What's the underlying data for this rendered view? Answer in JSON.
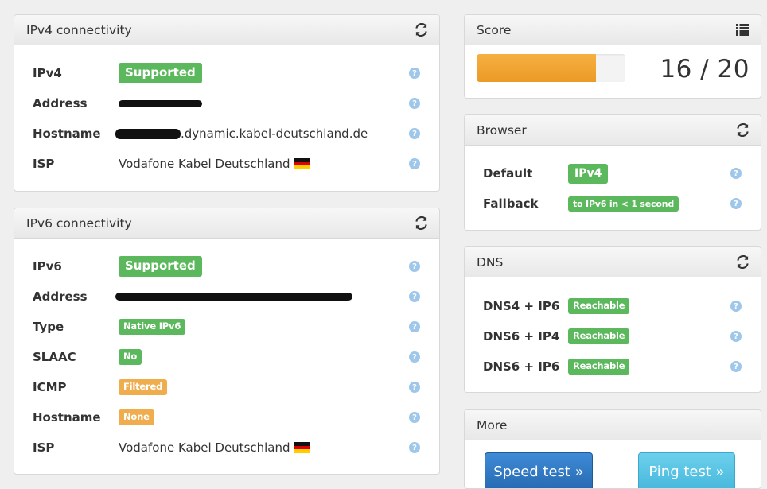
{
  "ipv4": {
    "title": "IPv4 connectivity",
    "rows": [
      {
        "label": "IPv4",
        "badge": "Supported"
      },
      {
        "label": "Address"
      },
      {
        "label": "Hostname",
        "suffix": ".dynamic.kabel-deutschland.de"
      },
      {
        "label": "ISP",
        "value": "Vodafone Kabel Deutschland"
      }
    ]
  },
  "ipv6": {
    "title": "IPv6 connectivity",
    "rows": [
      {
        "label": "IPv6",
        "badge": "Supported"
      },
      {
        "label": "Address"
      },
      {
        "label": "Type",
        "badge": "Native IPv6"
      },
      {
        "label": "SLAAC",
        "badge": "No"
      },
      {
        "label": "ICMP",
        "badge": "Filtered"
      },
      {
        "label": "Hostname",
        "badge": "None"
      },
      {
        "label": "ISP",
        "value": "Vodafone Kabel Deutschland"
      }
    ]
  },
  "score": {
    "title": "Score",
    "text": "16 / 20",
    "fraction": 0.8
  },
  "browser": {
    "title": "Browser",
    "rows": [
      {
        "label": "Default",
        "badge": "IPv4"
      },
      {
        "label": "Fallback",
        "badge": "to IPv6 in < 1 second"
      }
    ]
  },
  "dns": {
    "title": "DNS",
    "rows": [
      {
        "label": "DNS4 + IP6",
        "badge": "Reachable"
      },
      {
        "label": "DNS6 + IP4",
        "badge": "Reachable"
      },
      {
        "label": "DNS6 + IP6",
        "badge": "Reachable"
      }
    ]
  },
  "more": {
    "title": "More",
    "speed_test": "Speed test »",
    "ping_test": "Ping test »"
  },
  "help_glyph": "?",
  "icons": {
    "refresh": "refresh-icon",
    "list": "list-icon",
    "help": "help-icon",
    "flag": "germany-flag-icon"
  },
  "colors": {
    "success": "#5cb85c",
    "warning": "#f0ad4e",
    "help": "#9ec7ea",
    "score_fill": "#ec9a26",
    "primary": "#2569b0",
    "info": "#46b7dc"
  }
}
